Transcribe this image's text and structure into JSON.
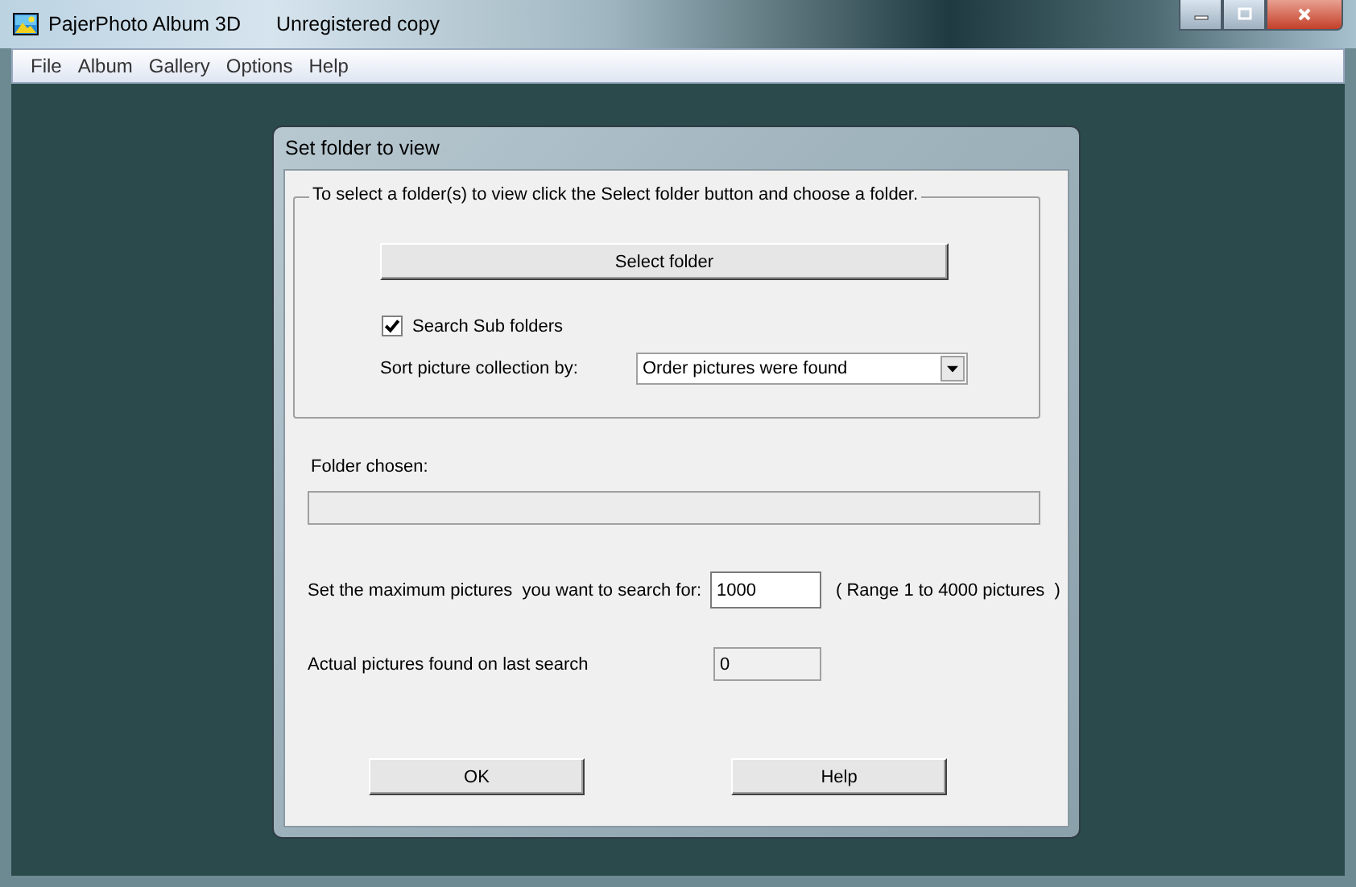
{
  "window": {
    "title": "PajerPhoto Album 3D",
    "subtitle": "Unregistered copy"
  },
  "menu": [
    "File",
    "Album",
    "Gallery",
    "Options",
    "Help"
  ],
  "dialog": {
    "title": "Set folder to view",
    "group_label": "To select a folder(s) to view click the Select folder button and choose a folder.",
    "select_button": "Select folder",
    "search_subfolders": {
      "label": "Search Sub folders",
      "checked": true
    },
    "sort": {
      "label": "Sort picture collection by:",
      "value": "Order pictures were found"
    },
    "folder_chosen": {
      "label": "Folder chosen:"
    },
    "max_pictures": {
      "label": "Set the maximum pictures  you want to search for:",
      "value": "1000",
      "range": "( Range 1 to 4000 pictures  )"
    },
    "found": {
      "label": "Actual pictures found on last search",
      "value": "0"
    },
    "buttons": [
      "OK",
      "Help"
    ]
  }
}
